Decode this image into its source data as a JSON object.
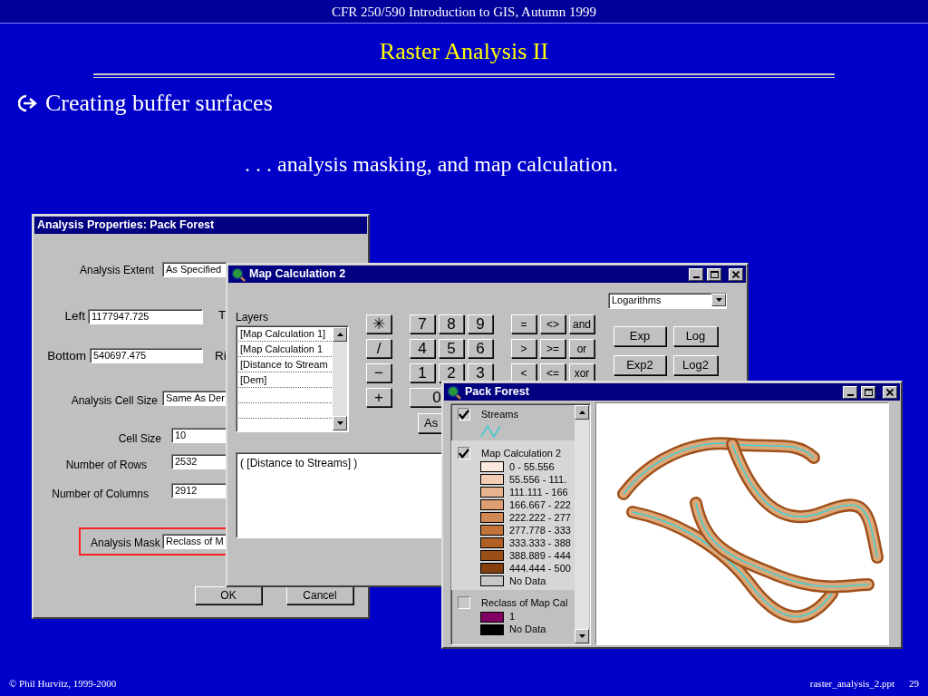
{
  "slide": {
    "course": "CFR 250/590 Introduction to GIS, Autumn 1999",
    "title": "Raster Analysis II",
    "bullet": "Creating buffer surfaces",
    "subtitle": ". . . analysis masking, and map calculation.",
    "footer_left": "© Phil Hurvitz, 1999-2000",
    "footer_file": "raster_analysis_2.ppt",
    "page": "29"
  },
  "analysis_properties": {
    "title": "Analysis Properties: Pack Forest",
    "fields": [
      {
        "label": "Analysis Extent",
        "value": "As Specified"
      },
      {
        "label": "Left",
        "value": "1177947.725"
      },
      {
        "label": "Bottom",
        "value": "540697.475"
      },
      {
        "label": "Analysis Cell Size",
        "value": "Same As Der"
      },
      {
        "label": "Cell Size",
        "value": "10"
      },
      {
        "label": "Number of Rows",
        "value": "2532"
      },
      {
        "label": "Number of Columns",
        "value": "2912"
      }
    ],
    "cut_labels": [
      "T",
      "Ri"
    ],
    "mask": {
      "label": "Analysis Mask",
      "value": "Reclass of M",
      "highlighted": true
    },
    "buttons": [
      "OK",
      "Cancel"
    ]
  },
  "map_calculation": {
    "title": "Map Calculation 2",
    "layers_label": "Layers",
    "layers": [
      "[Map Calculation 1]",
      "[Map Calculation 1",
      "[Distance to Stream",
      "[Dem]"
    ],
    "keypad": [
      [
        "✳",
        "7",
        "8",
        "9",
        "=",
        "<>",
        "and"
      ],
      [
        "/",
        "4",
        "5",
        "6",
        ">",
        ">=",
        "or"
      ],
      [
        "−",
        "1",
        "2",
        "3",
        "<",
        "<=",
        "xor"
      ],
      [
        "+",
        "0"
      ]
    ],
    "assign_button": "As",
    "function_group": "Logarithms",
    "functions": [
      "Exp",
      "Log",
      "Exp2",
      "Log2"
    ],
    "expression": "( [Distance to Streams] )"
  },
  "pack_forest": {
    "title": "Pack Forest",
    "legend": [
      {
        "kind": "line",
        "name": "Streams",
        "checked": true,
        "selected": false,
        "color": "#40c8d0"
      },
      {
        "kind": "classes",
        "name": "Map Calculation 2",
        "checked": true,
        "selected": true,
        "classes": [
          {
            "label": "0 - 55.556",
            "color": "#fbe8de"
          },
          {
            "label": "55.556 - 111.",
            "color": "#f2cdb4"
          },
          {
            "label": "111.111 - 166",
            "color": "#e8b490"
          },
          {
            "label": "166.667 - 222",
            "color": "#dd9e72"
          },
          {
            "label": "222.222 - 277",
            "color": "#d08854"
          },
          {
            "label": "277.778 - 333",
            "color": "#c2733a"
          },
          {
            "label": "333.333 - 388",
            "color": "#b06024"
          },
          {
            "label": "388.889 - 444",
            "color": "#9a4f16"
          },
          {
            "label": "444.444 - 500",
            "color": "#84400c"
          },
          {
            "label": "No Data",
            "color": "#c8c8c8"
          }
        ]
      },
      {
        "kind": "classes",
        "name": "Reclass of Map Cal",
        "checked": false,
        "selected": false,
        "classes": [
          {
            "label": "1",
            "color": "#800064"
          },
          {
            "label": "No Data",
            "color": "#000000"
          }
        ]
      }
    ]
  }
}
